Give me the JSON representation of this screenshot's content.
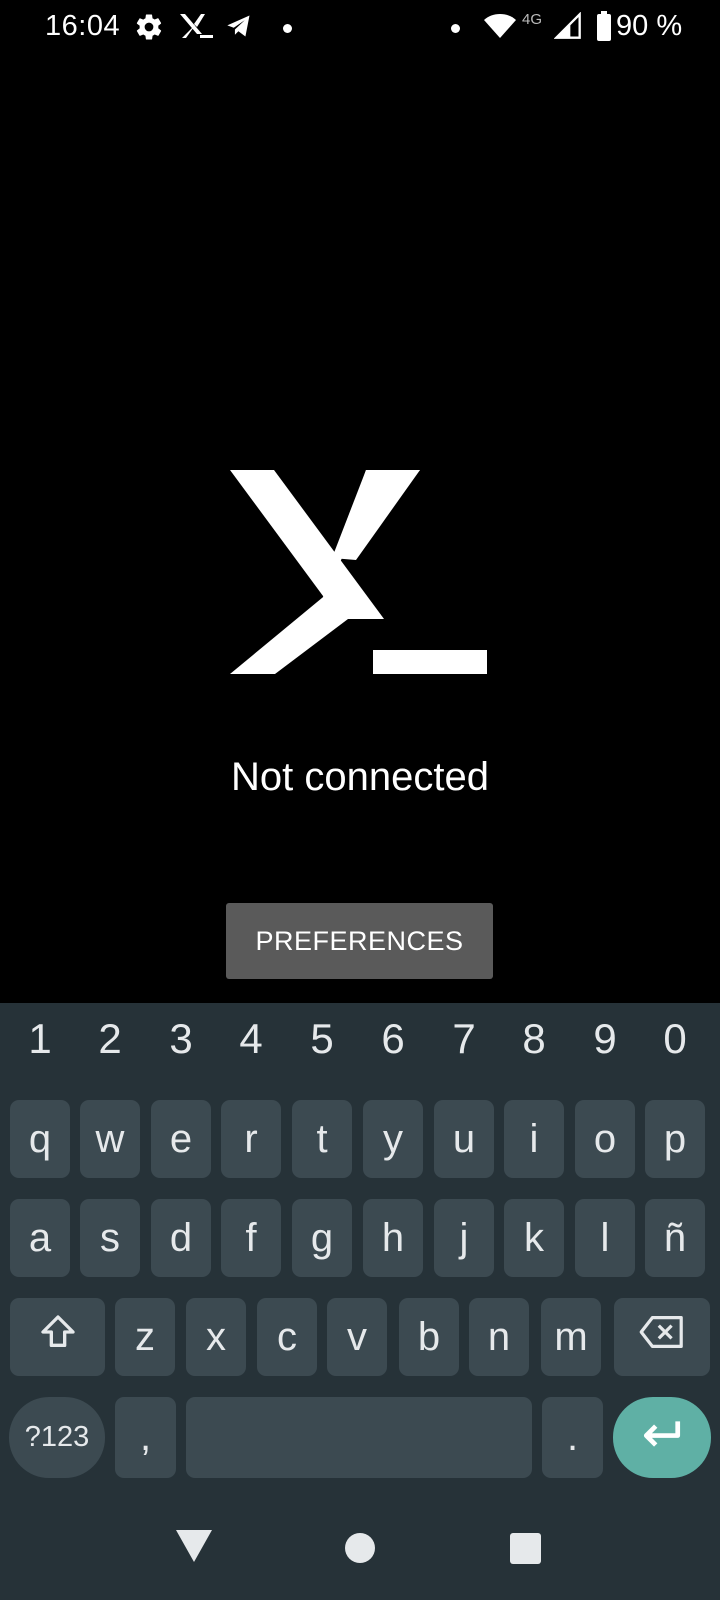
{
  "status_bar": {
    "time": "16:04",
    "network_type": "4G",
    "battery_text": "90 %",
    "icons": [
      "gear-icon",
      "terminal-app-icon",
      "telegram-icon",
      "notification-dot-icon",
      "notification-dot-icon",
      "wifi-icon",
      "cell-signal-icon",
      "battery-icon"
    ]
  },
  "main": {
    "status": "Not connected",
    "preferences_label": "PREFERENCES",
    "logo": "x-terminal-logo"
  },
  "keyboard": {
    "numbers": [
      "1",
      "2",
      "3",
      "4",
      "5",
      "6",
      "7",
      "8",
      "9",
      "0"
    ],
    "row1": [
      "q",
      "w",
      "e",
      "r",
      "t",
      "y",
      "u",
      "i",
      "o",
      "p"
    ],
    "row2": [
      "a",
      "s",
      "d",
      "f",
      "g",
      "h",
      "j",
      "k",
      "l",
      "ñ"
    ],
    "row3": [
      "z",
      "x",
      "c",
      "v",
      "b",
      "n",
      "m"
    ],
    "symbols_label": "?123",
    "comma": ",",
    "period": "."
  },
  "colors": {
    "background": "#000000",
    "keyboard_bg": "#263238",
    "key_bg": "#3c4a51",
    "enter_key": "#5fb0a5",
    "button_bg": "#5a5a5a"
  }
}
